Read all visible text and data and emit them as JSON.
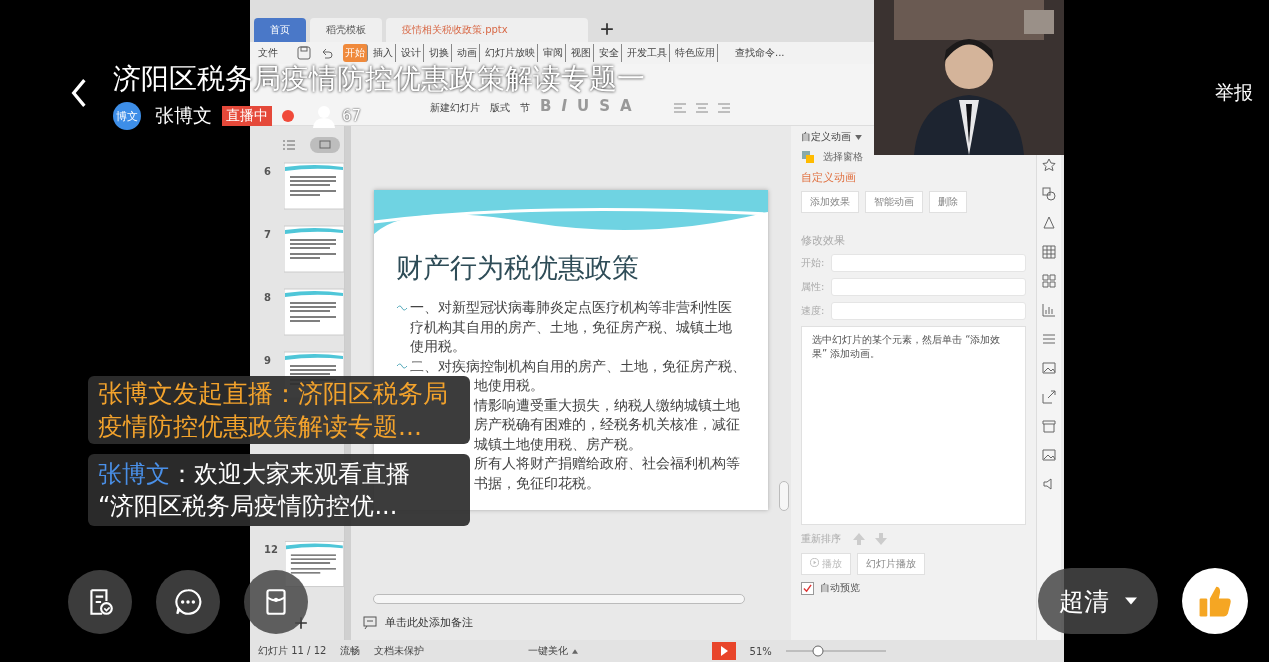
{
  "live": {
    "title": "济阳区税务局疫情防控优惠政策解读专题一",
    "host_avatar": "博文",
    "host": "张博文",
    "status": "直播中",
    "viewers": "67",
    "report": "举报"
  },
  "chat": [
    {
      "kind": "system",
      "lines": [
        "张博文发起直播：济阳区税务局",
        "疫情防控优惠政策解读专题..."
      ]
    },
    {
      "kind": "message",
      "author": "张博文",
      "lines": [
        "：欢迎大家来观看直播",
        "“济阳区税务局疫情防控优..."
      ]
    }
  ],
  "quality": "超清",
  "wps": {
    "tabs": [
      {
        "label": "首页",
        "selected": true
      },
      {
        "label": "稻壳模板",
        "selected": false
      },
      {
        "label": "疫情相关税收政策.pptx",
        "selected": false
      }
    ],
    "file_menu": "文件",
    "menu": [
      {
        "label": "开始",
        "selected": true
      },
      {
        "label": "插入",
        "selected": false
      },
      {
        "label": "设计",
        "selected": false
      },
      {
        "label": "切换",
        "selected": false
      },
      {
        "label": "动画",
        "selected": false
      },
      {
        "label": "幻灯片放映",
        "selected": false
      },
      {
        "label": "审阅",
        "selected": false
      },
      {
        "label": "视图",
        "selected": false
      },
      {
        "label": "安全",
        "selected": false
      },
      {
        "label": "开发工具",
        "selected": false
      },
      {
        "label": "特色应用",
        "selected": false
      }
    ],
    "search": "查找命令...",
    "ribbon": [
      "新建幻灯片",
      "版式",
      "节"
    ],
    "format_buttons": [
      "B",
      "I",
      "U",
      "S",
      "A"
    ],
    "thumbnails": [
      {
        "kind": "slide",
        "number": "6",
        "selected": false
      },
      {
        "kind": "slide",
        "number": "7",
        "selected": false
      },
      {
        "kind": "slide",
        "number": "8",
        "selected": false
      },
      {
        "kind": "slide",
        "number": "9",
        "selected": false
      },
      {
        "kind": "covered"
      },
      {
        "kind": "covered"
      },
      {
        "kind": "slide",
        "number": "12",
        "selected": false
      }
    ],
    "slide": {
      "title": "财产行为税优惠政策",
      "items": [
        {
          "lines": [
            {
              "text": "一、对新型冠状病毒肺炎定点医疗机构等非营利性医",
              "covered": false
            },
            {
              "text": "疗机构其自用的房产、土地，免征房产税、城镇土地",
              "covered": false
            },
            {
              "text": "使用税。",
              "covered": false
            }
          ]
        },
        {
          "lines": [
            {
              "text": "二、对疾病控制机构自用的房产、土地，免征房产税、",
              "covered": false
            },
            {
              "text": "地使用税。",
              "covered": true
            }
          ]
        },
        {
          "lines": [
            {
              "text": "情影响遭受重大损失，纳税人缴纳城镇土地",
              "covered": true
            },
            {
              "text": "房产税确有困难的，经税务机关核准，减征",
              "covered": true
            },
            {
              "text": "城镇土地使用税、房产税。",
              "covered": true
            }
          ]
        },
        {
          "lines": [
            {
              "text": "所有人将财产捐赠给政府、社会福利机构等",
              "covered": true
            },
            {
              "text": "书据，免征印花税。",
              "covered": true
            }
          ]
        }
      ]
    },
    "notes_placeholder": "单击此处添加备注",
    "panel": {
      "header": "自定义动画",
      "selection_pane": "选择窗格",
      "title": "自定义动画",
      "buttons": [
        "添加效果",
        "智能动画",
        "删除"
      ],
      "modify": "修改效果",
      "fields": [
        "开始:",
        "属性:",
        "速度:"
      ],
      "hint": "选中幻灯片的某个元素，然后单击 “添加效果” 添加动画。",
      "reorder": "重新排序",
      "play": "播放",
      "slideshow": "幻灯片播放",
      "autopreview": {
        "label": "自动预览",
        "checked": true
      }
    },
    "status": {
      "slide": "幻灯片 11 / 12",
      "mode": "流畅",
      "protect": "文档未保护",
      "beautify": "一键美化",
      "zoom": "51%",
      "zoom_slider": {
        "level": 0.3
      }
    }
  }
}
